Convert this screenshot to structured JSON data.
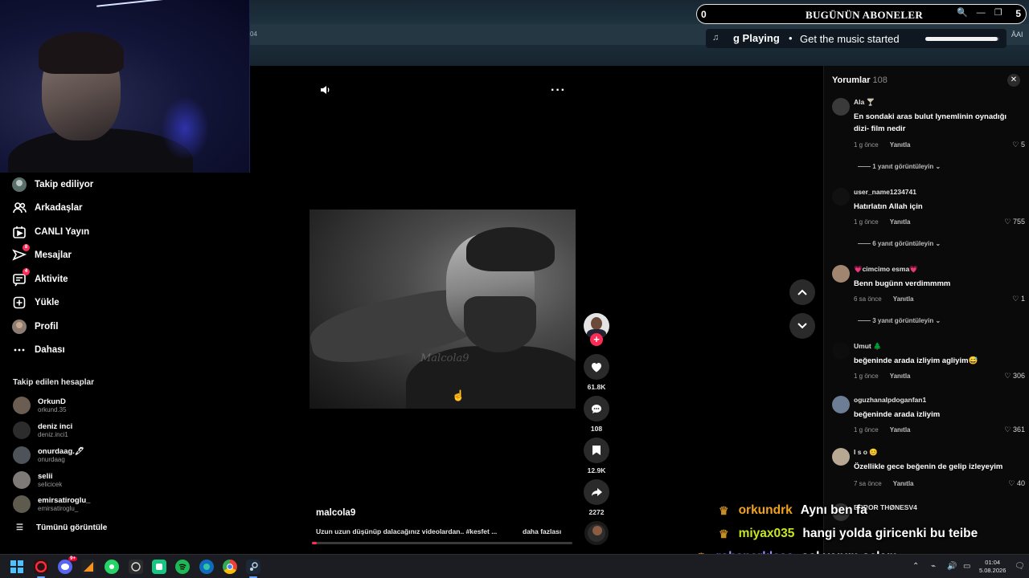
{
  "overlay": {
    "subscribers_left": "0",
    "subscribers_title": "BUGÜNÜN ABONELER",
    "subscribers_right": "5",
    "tab_fragment": "04",
    "music_label": "g Playing",
    "music_separator": "•",
    "music_message": "Get the music started",
    "music_progress": 0.98,
    "ai_tag": "ĀAI"
  },
  "sidebar": {
    "items": [
      {
        "label": "Takip ediliyor",
        "icon": "following-avatar-icon"
      },
      {
        "label": "Arkadaşlar",
        "icon": "friends-icon"
      },
      {
        "label": "CANLI Yayın",
        "icon": "live-icon"
      },
      {
        "label": "Mesajlar",
        "icon": "messages-icon",
        "badge": "8"
      },
      {
        "label": "Aktivite",
        "icon": "activity-icon",
        "badge": "4"
      },
      {
        "label": "Yükle",
        "icon": "upload-icon"
      },
      {
        "label": "Profil",
        "icon": "profile-avatar-icon"
      },
      {
        "label": "Dahası",
        "icon": "more-dots-icon"
      }
    ],
    "following_title": "Takip edilen hesaplar",
    "accounts": [
      {
        "name": "OrkunD",
        "handle": "orkund.35"
      },
      {
        "name": "deniz inci",
        "handle": "deniz.inci1"
      },
      {
        "name": "onurdaag.🖋",
        "handle": "onurdaag"
      },
      {
        "name": "selii",
        "handle": "selicicek"
      },
      {
        "name": "emirsatiroglu_",
        "handle": "emirsatiroglu_"
      }
    ],
    "see_all": "Tümünü görüntüle"
  },
  "video": {
    "watermark": "Malcola9",
    "author": "malcola9",
    "caption": "Uzun uzun düşünüp dalacağınız videolardan.. #kesfet ...",
    "more": "daha fazlası",
    "progress": 0.02,
    "likes": "61.8K",
    "comments": "108",
    "saves": "12.9K",
    "shares": "2272",
    "follow_plus": "+"
  },
  "comments": {
    "title": "Yorumlar",
    "count": "108",
    "close": "✕",
    "reply_label": "Yanıtla",
    "items": [
      {
        "user": "Ala 🍸",
        "text": "En sondaki aras bulut Iynemlinin oynadığı dizi- film nedir",
        "time": "1 g önce",
        "likes": "5",
        "replies": "1 yanıt görüntüleyin"
      },
      {
        "user": "user_name1234741",
        "text": "Hatırlatın Allah için",
        "time": "1 g önce",
        "likes": "755",
        "replies": "6 yanıt görüntüleyin"
      },
      {
        "user": "💗cimcimo esma💗",
        "text": "Benn bugünn verdimmmm",
        "time": "6 sa önce",
        "likes": "1",
        "replies": "3 yanıt görüntüleyin"
      },
      {
        "user": "Umut 🌲",
        "text": "beğeninde arada izliyim agliyim😅",
        "time": "1 g önce",
        "likes": "306"
      },
      {
        "user": "oguzhanalpdoganfan1",
        "text": "beğeninde arada izliyim",
        "time": "1 g önce",
        "likes": "361"
      },
      {
        "user": "I s o 😊",
        "text": "Özellikle gece beğenin de gelip izleyeyim",
        "time": "7 sa önce",
        "likes": "40"
      },
      {
        "user": "ERROR THØNESV4",
        "text": "",
        "time": "",
        "likes": ""
      }
    ]
  },
  "chat": [
    {
      "user": "orkundrk",
      "message": "Aynı ben fa",
      "user_color": "#f0a21e"
    },
    {
      "user": "miyax035",
      "message": "hangi yolda giricenki bu teibe",
      "user_color": "#c8e61e"
    },
    {
      "user": "robsparkless",
      "message": "sol yanım selam",
      "user_color": "#9d8cff"
    }
  ],
  "taskbar": {
    "time": "01:04",
    "date": "5.08.2026",
    "discord_badge": "9+"
  },
  "colors": {
    "accent": "#fe2c55",
    "background": "#000000"
  }
}
